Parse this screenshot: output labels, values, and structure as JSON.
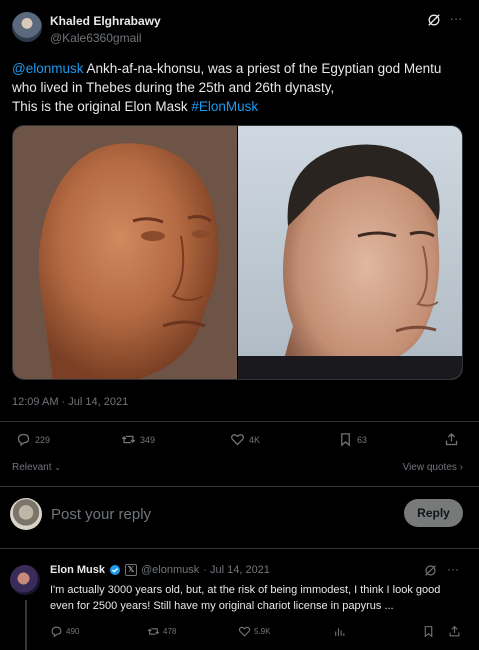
{
  "tweet": {
    "author_name": "Khaled Elghrabawy",
    "author_handle": "@Kale6360gmail",
    "text_mention": "@elonmusk",
    "text_body_1": " Ankh-af-na-khonsu, was a priest of the Egyptian god Mentu who lived in Thebes during the 25th and 26th dynasty,",
    "text_body_2": "This is the original Elon Mask ",
    "text_hashtag": "#ElonMusk",
    "timestamp": "12:09 AM · Jul 14, 2021",
    "replies": "229",
    "retweets": "349",
    "likes": "4K",
    "bookmarks": "63"
  },
  "sort": {
    "relevant_label": "Relevant",
    "view_quotes_label": "View quotes"
  },
  "reply_box": {
    "placeholder": "Post your reply",
    "button_label": "Reply"
  },
  "comment": {
    "author_name": "Elon Musk",
    "affiliate_badge": "𝕏",
    "handle": "@elonmusk",
    "date": "· Jul 14, 2021",
    "text": "I'm actually 3000 years old, but, at the risk of being immodest, I think I look good even for 2500 years! Still have my original chariot license in papyrus ...",
    "replies": "490",
    "retweets": "478",
    "likes": "5.9K"
  },
  "colors": {
    "background": "#000000",
    "text_primary": "#e7e9ea",
    "text_secondary": "#71767b",
    "link": "#1d9bf0",
    "verified": "#1d9bf0",
    "divider": "#2f3336"
  },
  "icons": [
    "grok-icon",
    "more-icon",
    "reply-icon",
    "retweet-icon",
    "like-icon",
    "bookmark-icon",
    "share-icon",
    "chevron-down-icon",
    "chevron-right-icon",
    "verified-icon",
    "views-icon"
  ]
}
